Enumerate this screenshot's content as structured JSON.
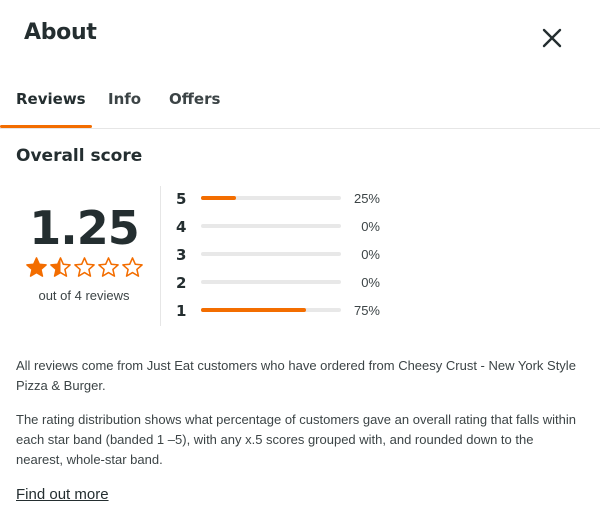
{
  "header": {
    "title": "About",
    "close_icon": "close-icon"
  },
  "tabs": [
    {
      "label": "Reviews",
      "active": true
    },
    {
      "label": "Info",
      "active": false
    },
    {
      "label": "Offers",
      "active": false
    }
  ],
  "overall": {
    "section_title": "Overall score",
    "score": "1.25",
    "rating": 1.25,
    "max_stars": 5,
    "reviews_text": "out of 4 reviews"
  },
  "distribution": [
    {
      "stars": "5",
      "fraction": 0.25,
      "percent": "25%"
    },
    {
      "stars": "4",
      "fraction": 0.0,
      "percent": "0%"
    },
    {
      "stars": "3",
      "fraction": 0.0,
      "percent": "0%"
    },
    {
      "stars": "2",
      "fraction": 0.0,
      "percent": "0%"
    },
    {
      "stars": "1",
      "fraction": 0.75,
      "percent": "75%"
    }
  ],
  "info": {
    "paragraph1": "All reviews come from Just Eat customers who have ordered from Cheesy Crust - New York Style Pizza & Burger.",
    "paragraph2": "The rating distribution shows what percentage of customers gave an overall rating that falls within each star band (banded 1 –5), with any x.5 scores grouped with, and rounded down to the nearest, whole-star band.",
    "link": "Find out more"
  },
  "colors": {
    "accent": "#f36d00",
    "text": "#242e30",
    "muted": "#3c4446",
    "track": "#e8e8e8"
  }
}
